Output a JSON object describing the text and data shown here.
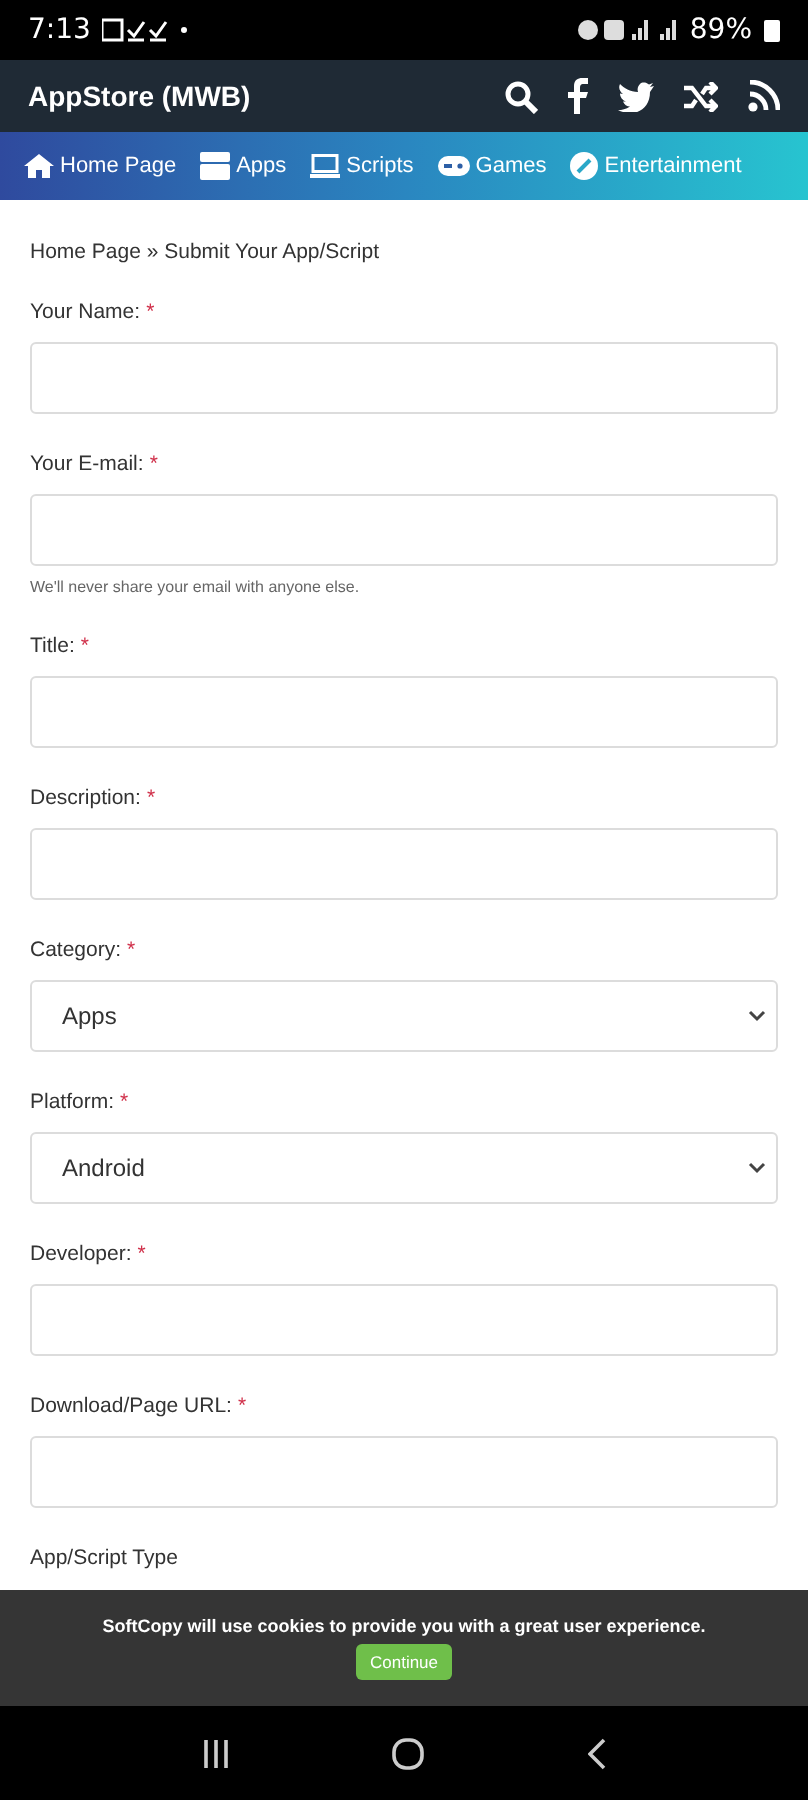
{
  "status_bar": {
    "time": "7:13",
    "battery": "89%"
  },
  "header": {
    "title": "AppStore (MWB)"
  },
  "nav": [
    {
      "label": "Home Page",
      "kind": "home"
    },
    {
      "label": "Apps",
      "kind": "apps"
    },
    {
      "label": "Scripts",
      "kind": "scripts"
    },
    {
      "label": "Games",
      "kind": "games"
    },
    {
      "label": "Entertainment",
      "kind": "entertainment"
    }
  ],
  "breadcrumb": "Home Page » Submit Your App/Script",
  "fields": [
    {
      "label": "Your Name:",
      "required": "*",
      "kind": "text"
    },
    {
      "label": "Your E-mail:",
      "required": "*",
      "kind": "text",
      "help": "We'll never share your email with anyone else."
    },
    {
      "label": "Title:",
      "required": "*",
      "kind": "text"
    },
    {
      "label": "Description:",
      "required": "*",
      "kind": "text"
    },
    {
      "label": "Category:",
      "required": "*",
      "kind": "select",
      "value": "Apps"
    },
    {
      "label": "Platform:",
      "required": "*",
      "kind": "select",
      "value": "Android"
    },
    {
      "label": "Developer:",
      "required": "*",
      "kind": "text"
    },
    {
      "label": "Download/Page URL:",
      "required": "*",
      "kind": "text"
    },
    {
      "label": "App/Script Type",
      "kind": "label"
    }
  ],
  "cookie": {
    "message": "SoftCopy will use cookies to provide you with a great user experience.",
    "button": "Continue"
  }
}
